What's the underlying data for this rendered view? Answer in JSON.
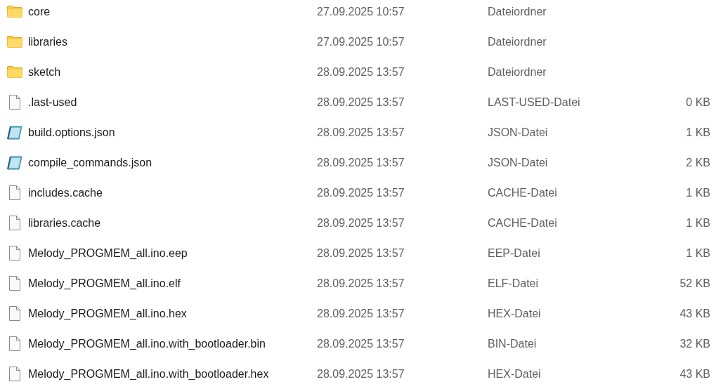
{
  "files": [
    {
      "kind": "folder",
      "name": "core",
      "date": "27.09.2025 10:57",
      "type": "Dateiordner"
    },
    {
      "kind": "folder",
      "name": "libraries",
      "date": "27.09.2025 10:57",
      "type": "Dateiordner"
    },
    {
      "kind": "folder",
      "name": "sketch",
      "date": "28.09.2025 13:57",
      "type": "Dateiordner"
    },
    {
      "kind": "file",
      "name": ".last-used",
      "date": "28.09.2025 13:57",
      "type": "LAST-USED-Datei",
      "size": "0 KB"
    },
    {
      "kind": "json",
      "name": "build.options.json",
      "date": "28.09.2025 13:57",
      "type": "JSON-Datei",
      "size": "1 KB"
    },
    {
      "kind": "json",
      "name": "compile_commands.json",
      "date": "28.09.2025 13:57",
      "type": "JSON-Datei",
      "size": "2 KB"
    },
    {
      "kind": "file",
      "name": "includes.cache",
      "date": "28.09.2025 13:57",
      "type": "CACHE-Datei",
      "size": "1 KB"
    },
    {
      "kind": "file",
      "name": "libraries.cache",
      "date": "28.09.2025 13:57",
      "type": "CACHE-Datei",
      "size": "1 KB"
    },
    {
      "kind": "file",
      "name": "Melody_PROGMEM_all.ino.eep",
      "date": "28.09.2025 13:57",
      "type": "EEP-Datei",
      "size": "1 KB"
    },
    {
      "kind": "file",
      "name": "Melody_PROGMEM_all.ino.elf",
      "date": "28.09.2025 13:57",
      "type": "ELF-Datei",
      "size": "52 KB"
    },
    {
      "kind": "file",
      "name": "Melody_PROGMEM_all.ino.hex",
      "date": "28.09.2025 13:57",
      "type": "HEX-Datei",
      "size": "43 KB"
    },
    {
      "kind": "file",
      "name": "Melody_PROGMEM_all.ino.with_bootloader.bin",
      "date": "28.09.2025 13:57",
      "type": "BIN-Datei",
      "size": "32 KB"
    },
    {
      "kind": "file",
      "name": "Melody_PROGMEM_all.ino.with_bootloader.hex",
      "date": "28.09.2025 13:57",
      "type": "HEX-Datei",
      "size": "43 KB"
    }
  ]
}
